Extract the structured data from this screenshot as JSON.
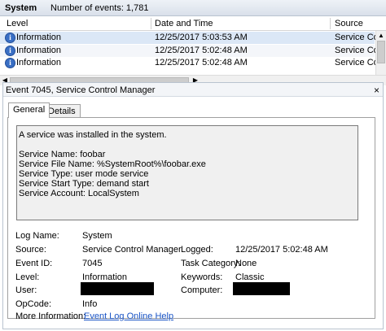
{
  "header": {
    "log_name": "System",
    "event_count": "Number of events: 1,781"
  },
  "table": {
    "columns": [
      "Level",
      "Date and Time",
      "Source"
    ],
    "rows": [
      {
        "level": "Information",
        "datetime": "12/25/2017 5:03:53 AM",
        "source": "Service Con"
      },
      {
        "level": "Information",
        "datetime": "12/25/2017 5:02:48 AM",
        "source": "Service Con"
      },
      {
        "level": "Information",
        "datetime": "12/25/2017 5:02:48 AM",
        "source": "Service Con"
      }
    ]
  },
  "detail": {
    "title": "Event 7045, Service Control Manager",
    "tabs": [
      "General",
      "Details"
    ],
    "description": [
      "A service was installed in the system.",
      "",
      "Service Name:  foobar",
      "Service File Name:  %SystemRoot%\\foobar.exe",
      "Service Type:  user mode service",
      "Service Start Type:  demand start",
      "Service Account:  LocalSystem"
    ],
    "fields": {
      "log_name_label": "Log Name:",
      "log_name": "System",
      "source_label": "Source:",
      "source": "Service Control Manager",
      "logged_label": "Logged:",
      "logged": "12/25/2017 5:02:48 AM",
      "event_id_label": "Event ID:",
      "event_id": "7045",
      "task_category_label": "Task Category:",
      "task_category": "None",
      "level_label": "Level:",
      "level": "Information",
      "keywords_label": "Keywords:",
      "keywords": "Classic",
      "user_label": "User:",
      "computer_label": "Computer:",
      "opcode_label": "OpCode:",
      "opcode": "Info",
      "more_info_label": "More Information:",
      "more_info_link": "Event Log Online Help"
    }
  },
  "colors": {
    "link": "#1a55c6",
    "selected_row": "#dbe7f6",
    "info_icon": "#3a6fc4",
    "redaction": "#000000"
  }
}
